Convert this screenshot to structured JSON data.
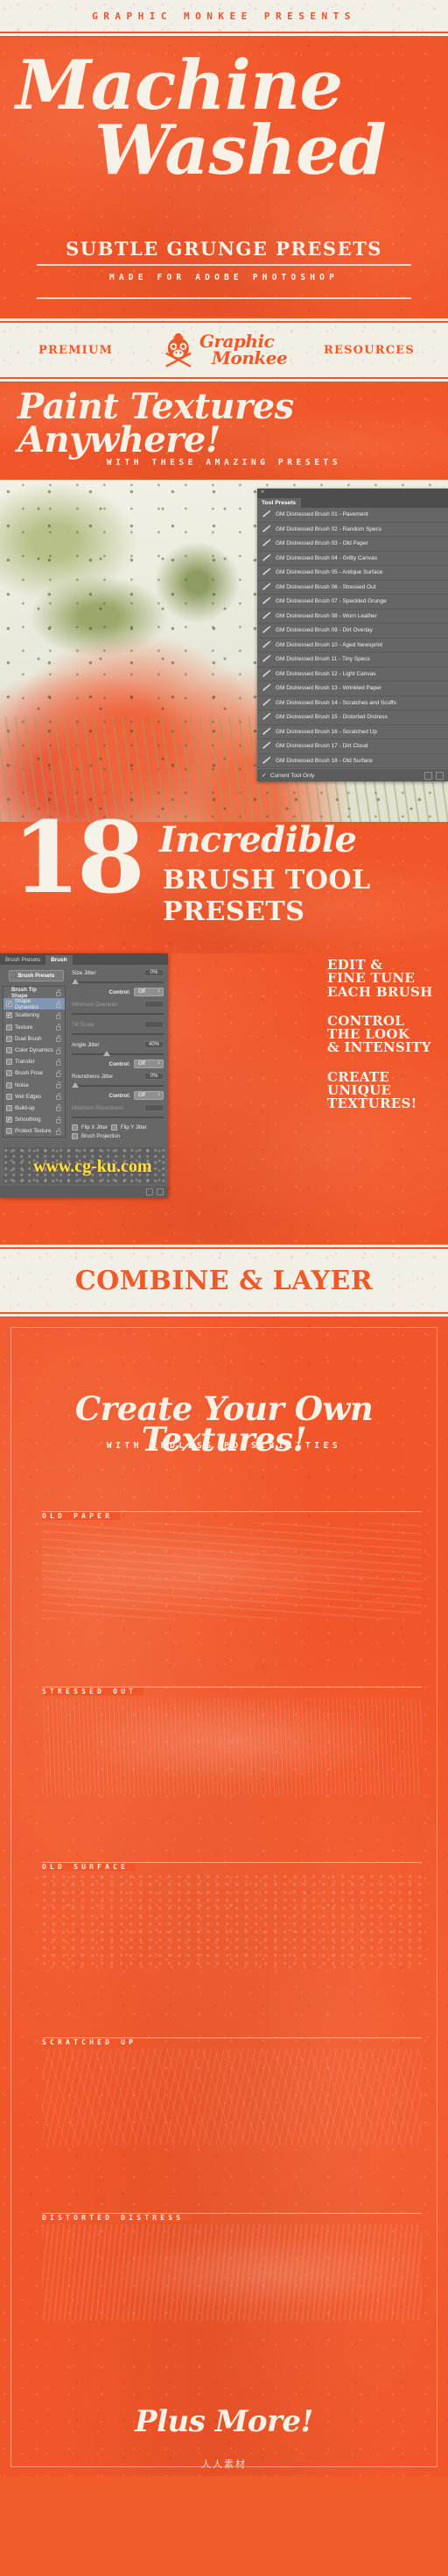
{
  "brand": {
    "presenter": "GRAPHIC MONKEE PRESENTS",
    "premium": "PREMIUM",
    "resources": "RESOURCES",
    "logo_line1": "Graphic",
    "logo_line2": "Monkee",
    "accent_orange": "#F1562A",
    "cream": "#F7F2E7"
  },
  "hero": {
    "title_line1": "Machine",
    "title_line2": "Washed",
    "subtitle": "SUBTLE GRUNGE PRESETS",
    "made_for": "MADE FOR ADOBE PHOTOSHOP"
  },
  "paint_band": {
    "headline": "Paint Textures Anywhere!",
    "subhead": "WITH THESE AMAZING PRESETS"
  },
  "tool_presets_panel": {
    "close_icon": "close-icon",
    "tab_label": "Tool Presets",
    "footer_checkbox_label": "Current Tool Only",
    "footer_checked": true,
    "footer_icons": [
      "new-preset-icon",
      "delete-preset-icon"
    ],
    "items": [
      {
        "icon": "brush-icon",
        "label": "GM Distressed Brush 01 - Pavement"
      },
      {
        "icon": "brush-icon",
        "label": "GM Distressed Brush 02 - Random Specs"
      },
      {
        "icon": "brush-icon",
        "label": "GM Distressed Brush 03 - Old Paper"
      },
      {
        "icon": "brush-icon",
        "label": "GM Distressed Brush 04 - Gritty Canvas"
      },
      {
        "icon": "brush-icon",
        "label": "GM Distressed Brush 05 - Antique Surface"
      },
      {
        "icon": "brush-icon",
        "label": "GM Distressed Brush 06 - Stressed Out"
      },
      {
        "icon": "brush-icon",
        "label": "GM Distressed Brush 07 - Speckled Grunge"
      },
      {
        "icon": "brush-icon",
        "label": "GM Distressed Brush 08 - Worn Leather"
      },
      {
        "icon": "brush-icon",
        "label": "GM Distressed Brush 09 - Dirt Overlay"
      },
      {
        "icon": "brush-icon",
        "label": "GM Distressed Brush 10 - Aged Newsprint"
      },
      {
        "icon": "brush-icon",
        "label": "GM Distressed Brush 11 - Tiny Specs"
      },
      {
        "icon": "brush-icon",
        "label": "GM Distressed Brush 12 - Light Canvas"
      },
      {
        "icon": "brush-icon",
        "label": "GM Distressed Brush 13 - Wrinkled Paper"
      },
      {
        "icon": "brush-icon",
        "label": "GM Distressed Brush 14 - Scratches and Scuffs"
      },
      {
        "icon": "brush-icon",
        "label": "GM Distressed Brush 15 - Distorted Distress"
      },
      {
        "icon": "brush-icon",
        "label": "GM Distressed Brush 16 - Scratched Up"
      },
      {
        "icon": "brush-icon",
        "label": "GM Distressed Brush 17 - Dirt Cloud"
      },
      {
        "icon": "brush-icon",
        "label": "GM Distressed Brush 18 - Old Surface"
      }
    ]
  },
  "count_band": {
    "number": "18",
    "script": "Incredible",
    "line1": "BRUSH TOOL",
    "line2": "PRESETS"
  },
  "brush_panel": {
    "tabs": [
      {
        "label": "Brush Presets",
        "active": false
      },
      {
        "label": "Brush",
        "active": true
      }
    ],
    "preset_button": "Brush Presets",
    "options": [
      {
        "label": "Brush Tip Shape",
        "checkbox": false,
        "checked": false,
        "selected": false,
        "lock": "unlock-icon"
      },
      {
        "label": "Shape Dynamics",
        "checkbox": true,
        "checked": true,
        "selected": true,
        "lock": "unlock-icon"
      },
      {
        "label": "Scattering",
        "checkbox": true,
        "checked": true,
        "selected": false,
        "lock": "unlock-icon"
      },
      {
        "label": "Texture",
        "checkbox": true,
        "checked": false,
        "selected": false,
        "lock": "unlock-icon"
      },
      {
        "label": "Dual Brush",
        "checkbox": true,
        "checked": false,
        "selected": false,
        "lock": "unlock-icon"
      },
      {
        "label": "Color Dynamics",
        "checkbox": true,
        "checked": false,
        "selected": false,
        "lock": "unlock-icon"
      },
      {
        "label": "Transfer",
        "checkbox": true,
        "checked": false,
        "selected": false,
        "lock": "unlock-icon"
      },
      {
        "label": "Brush Pose",
        "checkbox": true,
        "checked": false,
        "selected": false,
        "lock": "unlock-icon"
      },
      {
        "label": "Noise",
        "checkbox": true,
        "checked": false,
        "selected": false,
        "lock": "unlock-icon"
      },
      {
        "label": "Wet Edges",
        "checkbox": true,
        "checked": false,
        "selected": false,
        "lock": "unlock-icon"
      },
      {
        "label": "Build-up",
        "checkbox": true,
        "checked": false,
        "selected": false,
        "lock": "unlock-icon"
      },
      {
        "label": "Smoothing",
        "checkbox": true,
        "checked": true,
        "selected": false,
        "lock": "unlock-icon"
      },
      {
        "label": "Protect Texture",
        "checkbox": true,
        "checked": false,
        "selected": false,
        "lock": "unlock-icon"
      }
    ],
    "fields": {
      "size_jitter_label": "Size Jitter",
      "size_jitter_value": "0%",
      "size_control_label": "Control:",
      "size_control_value": "Off",
      "minimum_diameter_label": "Minimum Diameter",
      "tilt_scale_label": "Tilt Scale",
      "angle_jitter_label": "Angle Jitter",
      "angle_jitter_value": "40%",
      "angle_control_label": "Control:",
      "angle_control_value": "Off",
      "roundness_jitter_label": "Roundness Jitter",
      "roundness_jitter_value": "0%",
      "roundness_control_label": "Control:",
      "roundness_control_value": "Off",
      "minimum_roundness_label": "Minimum Roundness",
      "flip_x_label": "Flip X Jitter",
      "flip_y_label": "Flip Y Jitter",
      "brush_projection_label": "Brush Projection"
    },
    "footer_icons": [
      "new-brush-icon",
      "delete-brush-icon"
    ]
  },
  "callouts": [
    {
      "lines": [
        "EDIT &",
        "FINE TUNE",
        "EACH BRUSH"
      ]
    },
    {
      "lines": [
        "CONTROL",
        "THE LOOK",
        "& INTENSITY"
      ]
    },
    {
      "lines": [
        "CREATE",
        "UNIQUE",
        "TEXTURES!"
      ]
    }
  ],
  "watermark": "www.cg-ku.com",
  "combine_band": {
    "title": "COMBINE & LAYER"
  },
  "textures_board": {
    "headline": "Create Your Own Textures!",
    "subhead": "WITH ENDLESS POSSIBILITIES",
    "swatches": [
      {
        "label": "OLD PAPER",
        "style": "paper1"
      },
      {
        "label": "STRESSED OUT",
        "style": "stress"
      },
      {
        "label": "OLD SURFACE",
        "style": "surface"
      },
      {
        "label": "SCRATCHED UP",
        "style": "scratch"
      },
      {
        "label": "DISTORTED DISTRESS",
        "style": "distort"
      }
    ],
    "plus_more": "Plus More!",
    "footer_logo": "人人素材"
  }
}
